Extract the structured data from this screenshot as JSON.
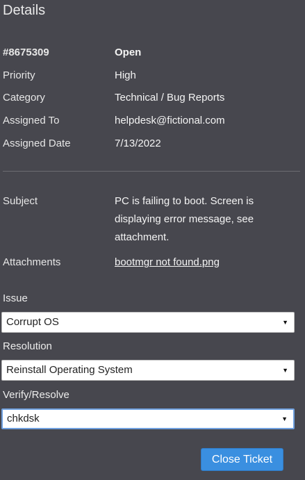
{
  "panel": {
    "title": "Details"
  },
  "ticket": {
    "id": "#8675309",
    "status": "Open",
    "fields": [
      {
        "key": "Priority",
        "value": "High"
      },
      {
        "key": "Category",
        "value": "Technical / Bug Reports"
      },
      {
        "key": "Assigned To",
        "value": "helpdesk@fictional.com"
      },
      {
        "key": "Assigned Date",
        "value": "7/13/2022"
      }
    ],
    "subject_label": "Subject",
    "subject_lines": [
      "PC is failing to boot. Screen is",
      "displaying error message, see",
      "attachment."
    ],
    "attachments_label": "Attachments",
    "attachment_link": "bootmgr not found.png"
  },
  "form": {
    "issue_label": "Issue",
    "issue_value": "Corrupt OS",
    "resolution_label": "Resolution",
    "resolution_value": "Reinstall Operating System",
    "verify_label": "Verify/Resolve",
    "verify_value": "chkdsk",
    "dropdown_arrow": "▼",
    "close_button": "Close Ticket"
  },
  "colors": {
    "background": "#47474e",
    "link": "#5fa1df",
    "button": "#3a8fe0",
    "focus_border": "#6fa0df"
  }
}
